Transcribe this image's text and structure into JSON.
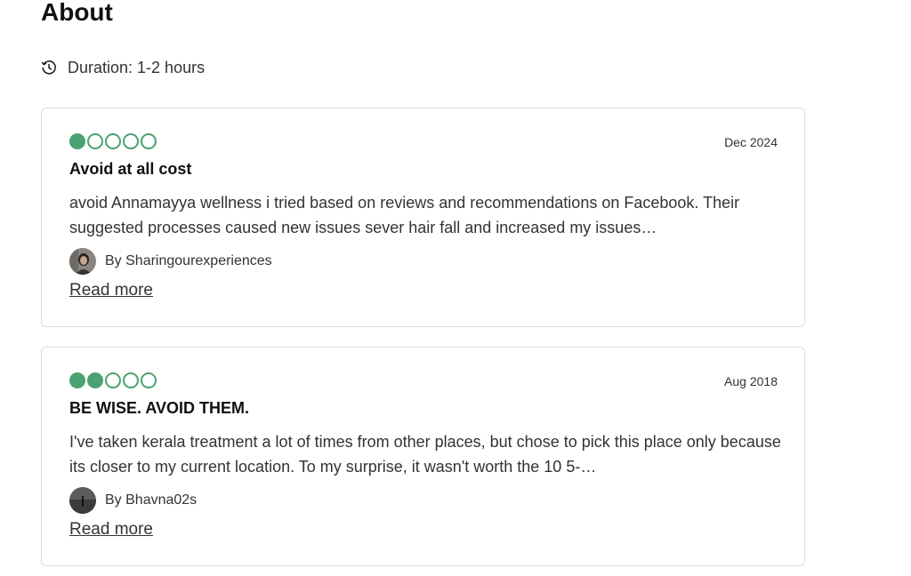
{
  "about": {
    "title": "About",
    "duration": "Duration: 1-2 hours"
  },
  "colors": {
    "bubble": "#4aa271"
  },
  "reviews": [
    {
      "rating": 1,
      "max_rating": 5,
      "date": "Dec 2024",
      "title": "Avoid at all cost",
      "body": "avoid Annamayya wellness i tried based on reviews and recommendations on Facebook. Their suggested processes caused new issues sever hair fall and increased my issues…",
      "author": "By Sharingourexperiences",
      "read_more": "Read more"
    },
    {
      "rating": 2,
      "max_rating": 5,
      "date": "Aug 2018",
      "title": "BE WISE. AVOID THEM.",
      "body": "I've taken kerala treatment a lot of times from other places, but chose to pick this place only because its closer to my current location. To my surprise, it wasn't worth the 10 5-…",
      "author": "By Bhavna02s",
      "read_more": "Read more"
    }
  ]
}
